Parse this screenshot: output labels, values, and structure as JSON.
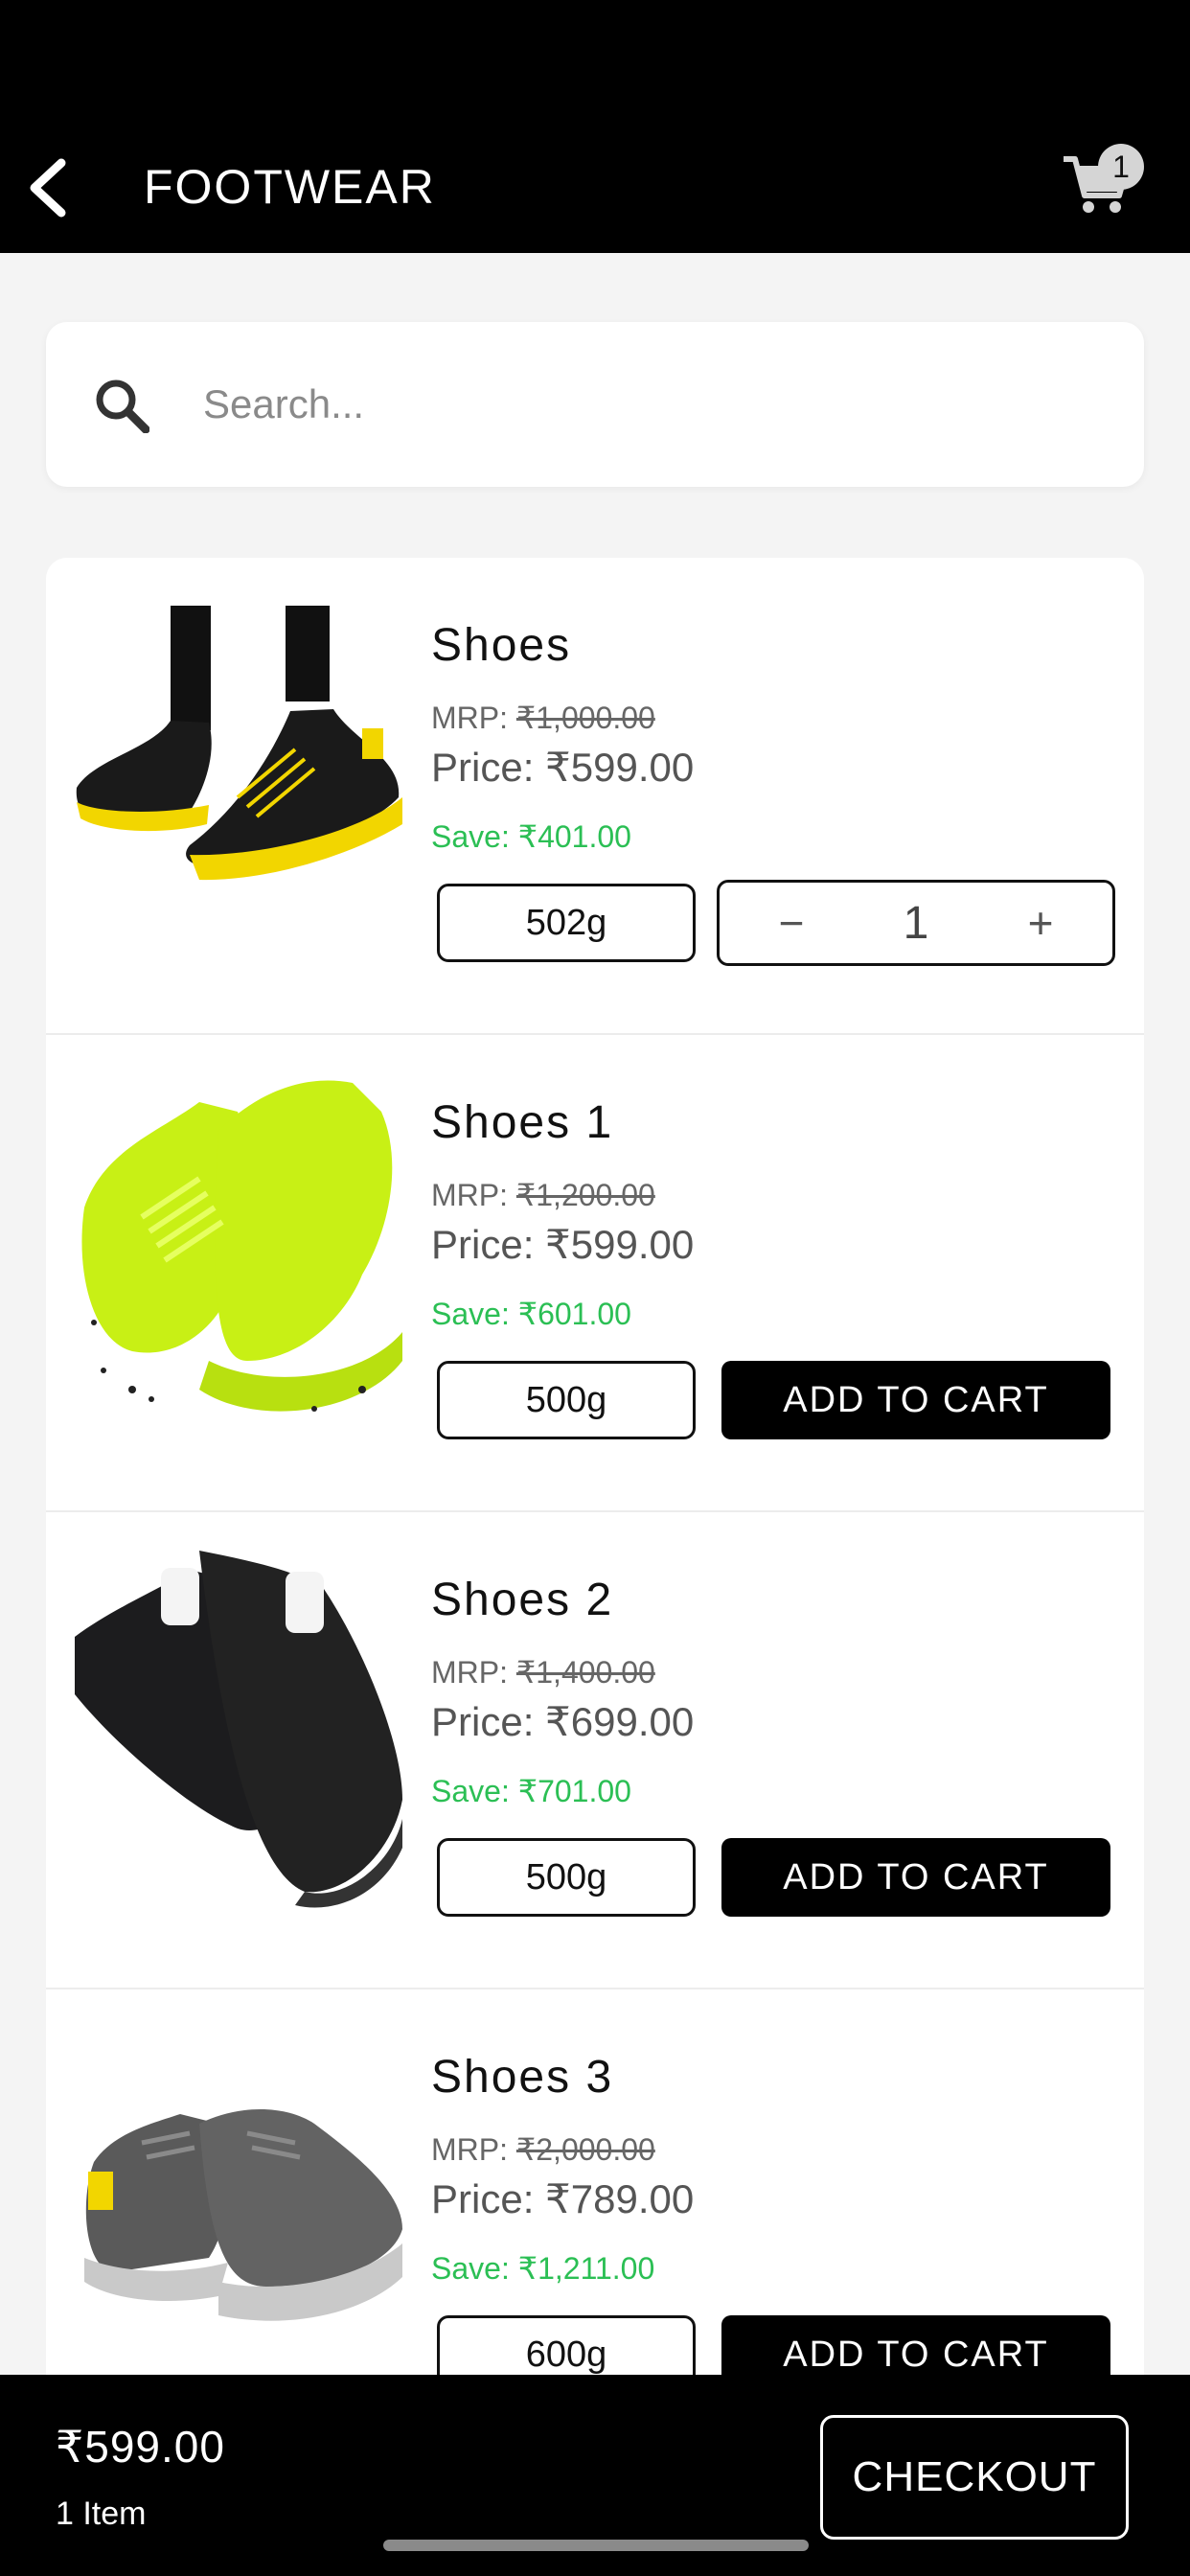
{
  "header": {
    "title": "FOOTWEAR",
    "cart_count": "1"
  },
  "search": {
    "placeholder": "Search..."
  },
  "products": [
    {
      "name": "Shoes",
      "mrp_label": "MRP:",
      "mrp": "₹1,000.00",
      "price": "Price: ₹599.00",
      "save": "Save: ₹401.00",
      "weight": "502g",
      "in_cart": true,
      "quantity": "1",
      "image": "black-yellow-sneakers"
    },
    {
      "name": "Shoes 1",
      "mrp_label": "MRP:",
      "mrp": "₹1,200.00",
      "price": "Price: ₹599.00",
      "save": "Save: ₹601.00",
      "weight": "500g",
      "in_cart": false,
      "action": "ADD TO CART",
      "image": "neon-green-sneakers"
    },
    {
      "name": "Shoes 2",
      "mrp_label": "MRP:",
      "mrp": "₹1,400.00",
      "price": "Price: ₹699.00",
      "save": "Save: ₹701.00",
      "weight": "500g",
      "in_cart": false,
      "action": "ADD TO CART",
      "image": "black-white-sneakers"
    },
    {
      "name": "Shoes 3",
      "mrp_label": "MRP:",
      "mrp": "₹2,000.00",
      "price": "Price: ₹789.00",
      "save": "Save: ₹1,211.00",
      "weight": "600g",
      "in_cart": false,
      "action": "ADD TO CART",
      "image": "grey-yellow-sneakers"
    }
  ],
  "footer": {
    "total": "₹599.00",
    "items": "1 Item",
    "checkout_label": "CHECKOUT"
  },
  "colors": {
    "header_bg": "#000000",
    "save_green": "#2bbf54",
    "button_bg": "#000000",
    "background": "#f4f4f4"
  },
  "icons": [
    "back-arrow-icon",
    "cart-icon",
    "search-icon",
    "minus-icon",
    "plus-icon"
  ]
}
